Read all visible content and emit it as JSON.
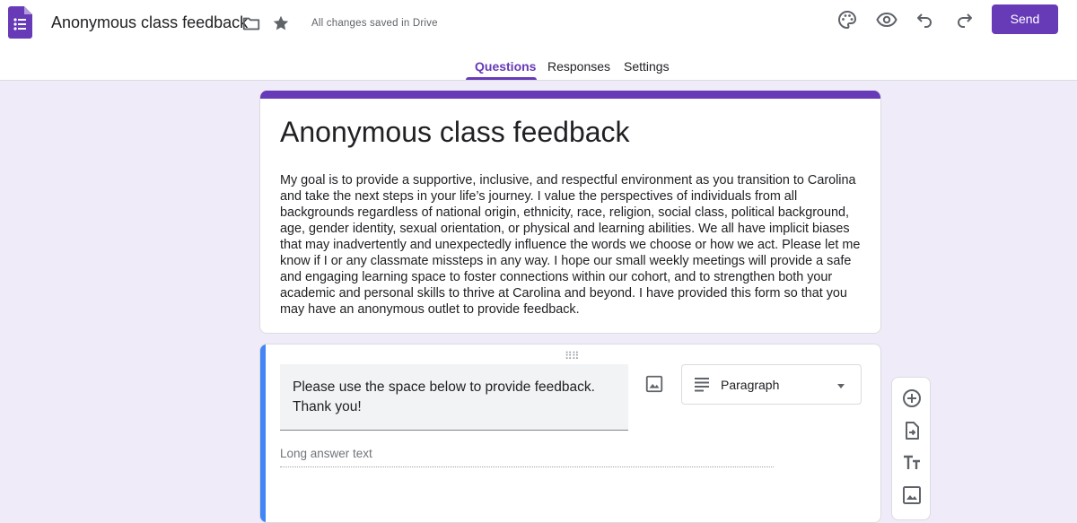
{
  "header": {
    "title": "Anonymous class feedback",
    "save_status": "All changes saved in Drive",
    "send_label": "Send",
    "accent_color": "#673ab7"
  },
  "icons": {
    "app": "google-forms-icon",
    "folder": "folder-icon",
    "star": "star-icon",
    "palette": "palette-icon",
    "preview": "eye-icon",
    "undo": "undo-icon",
    "redo": "redo-icon",
    "add_image": "image-icon",
    "question_type": "paragraph-lines-icon",
    "dropdown": "dropdown-caret-icon",
    "drag": "drag-handle-icon"
  },
  "tabs": [
    {
      "label": "Questions",
      "active": true
    },
    {
      "label": "Responses",
      "active": false
    },
    {
      "label": "Settings",
      "active": false
    }
  ],
  "form": {
    "title": "Anonymous class feedback",
    "description": "My goal is to provide a supportive, inclusive, and respectful environment as you transition to Carolina and take the next steps in your life’s journey. I value the perspectives of individuals from all backgrounds regardless of national origin, ethnicity, race, religion, social class, political background, age, gender identity, sexual orientation, or physical and learning abilities. We all have implicit biases that may inadvertently and unexpectedly influence the words we choose or how we act. Please let me know if I or any classmate missteps in any way. I hope our small weekly meetings will provide a safe and engaging learning space to foster connections within our cohort, and to strengthen both your academic and personal skills to thrive at Carolina and beyond. I have provided this form so that you may have an anonymous outlet to provide feedback."
  },
  "question": {
    "text": "Please use the space below to provide feedback. Thank you!",
    "type": "Paragraph",
    "answer_placeholder": "Long answer text"
  },
  "tools": [
    {
      "icon": "add-circle-icon"
    },
    {
      "icon": "import-questions-icon"
    },
    {
      "icon": "add-title-icon"
    },
    {
      "icon": "add-image-icon"
    }
  ]
}
